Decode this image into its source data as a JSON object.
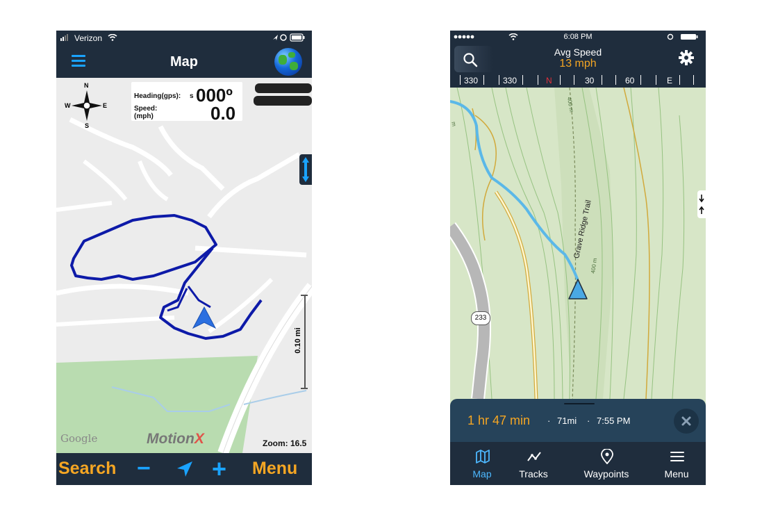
{
  "left_app": {
    "status": {
      "carrier": "Verizon"
    },
    "title": "Map",
    "hud": {
      "heading_label": "Heading(gps):",
      "heading_label_tail": "s",
      "heading_value": "000º",
      "speed_label": "Speed:",
      "speed_unit": "(mph)",
      "speed_value": "0.0"
    },
    "compass_rose": {
      "n": "N",
      "s": "S",
      "e": "E",
      "w": "W"
    },
    "scale_label": "0.10 mi",
    "google_logo": "Google",
    "brand_logo": {
      "text_main": "Motion",
      "text_accent": "X"
    },
    "zoom_label": "Zoom: 16.5",
    "bottom_bar": {
      "search_label": "Search",
      "minus_label": "−",
      "plus_label": "+",
      "menu_label": "Menu"
    },
    "colors": {
      "bar": "#1f2d3d",
      "accent": "#f5a623",
      "blue": "#1aa3ff",
      "track": "#0d1aa8"
    }
  },
  "right_app": {
    "status": {
      "time": "6:08 PM"
    },
    "header": {
      "label": "Avg Speed",
      "value": "13 mph"
    },
    "compass_labels": [
      "330",
      "330",
      "N",
      "30",
      "60",
      "E"
    ],
    "map": {
      "trail_label": "Grave Ridge Trail",
      "contour_label_1": "400 m",
      "contour_label_2": "400 m",
      "road_shield": "233",
      "edge_label": "m"
    },
    "route_panel": {
      "duration": "1 hr 47 min",
      "sep1": "·",
      "distance": "71mi",
      "sep2": "·",
      "eta": "7:55 PM"
    },
    "tabs": [
      {
        "label": "Map",
        "icon": "map-icon",
        "active": true
      },
      {
        "label": "Tracks",
        "icon": "tracks-icon",
        "active": false
      },
      {
        "label": "Waypoints",
        "icon": "waypoint-pin-icon",
        "active": false
      },
      {
        "label": "Menu",
        "icon": "menu-icon",
        "active": false
      }
    ],
    "colors": {
      "bar": "#1f2d3d",
      "accent": "#f5a623",
      "active_tab": "#4db8ff",
      "route": "#5bb8e8",
      "map_bg": "#d7e6c7"
    }
  }
}
